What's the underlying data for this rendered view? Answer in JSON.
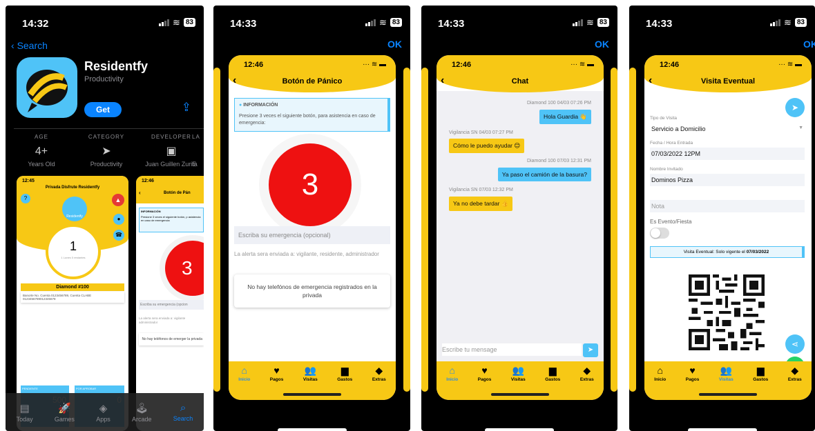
{
  "colors": {
    "accent_yellow": "#f7c815",
    "accent_blue": "#4fc3f7",
    "ios_blue": "#0a84ff",
    "panic_red": "#e11111"
  },
  "shot1": {
    "status": {
      "time": "14:32",
      "battery": "83"
    },
    "back_label": "Search",
    "app": {
      "name": "Residentfy",
      "category": "Productivity",
      "get_label": "Get"
    },
    "info": [
      {
        "header": "AGE",
        "value": "4+",
        "sub": "Years Old"
      },
      {
        "header": "CATEGORY",
        "value_icon": "location-arrow-icon",
        "sub": "Productivity"
      },
      {
        "header": "DEVELOPER",
        "value_icon": "person-square-icon",
        "sub": "Juan Guillen Zurita"
      },
      {
        "header": "LA",
        "value": "",
        "sub": "E"
      }
    ],
    "preview1": {
      "time": "12:45",
      "title": "Privada Disfrute Residentfy",
      "brand": "Residentfy",
      "count": "1",
      "count_sub": "1 Lunes 0 restantes",
      "name": "Diamond #100",
      "bank": "Banorte No. Cuenta 0123456789, Cuenta CLABE 0123456789012345678",
      "pend": "PENDIENTE",
      "pend_val": "500",
      "aprob": "POR APROBAR",
      "aprob_val": "0"
    },
    "preview2": {
      "time": "12:46",
      "title": "Botón de Pán",
      "info_title": "INFORMACIÓN",
      "info_text": "Presione 3 veces el siguiente botón, p asistencia en caso de emergencia",
      "number": "3",
      "placeholder": "Escriba su emergencia (opcion",
      "note": "La alerta sera enviada a: vigilante administrador",
      "card": "No hay teléfonos de emerger la privada"
    },
    "tabs": [
      {
        "label": "Today",
        "glyph": "▤",
        "active": false
      },
      {
        "label": "Games",
        "glyph": "🚀",
        "active": false
      },
      {
        "label": "Apps",
        "glyph": "◈",
        "active": false
      },
      {
        "label": "Arcade",
        "glyph": "🕹",
        "active": false
      },
      {
        "label": "Search",
        "glyph": "⌕",
        "active": true
      }
    ]
  },
  "shot2": {
    "status": {
      "time": "14:33",
      "battery": "83"
    },
    "ok_label": "OK",
    "phone_time": "12:46",
    "title": "Botón de Pánico",
    "info_title": "INFORMACIÓN",
    "info_text": "Presione 3 veces el siguiente botón, para asistencia en caso de emergencia:",
    "number": "3",
    "placeholder": "Escriba su emergencia (opcional)",
    "note": "La alerta sera enviada a: vigilante, residente, administrador",
    "card": "No hay telefónos de emergencia registrados en la privada"
  },
  "shot3": {
    "status": {
      "time": "14:33",
      "battery": "83"
    },
    "ok_label": "OK",
    "phone_time": "12:46",
    "title": "Chat",
    "messages": [
      {
        "from": "me",
        "meta": "Diamond 100  04/03 07:26 PM",
        "text": "Hola Guardia 👋"
      },
      {
        "from": "them",
        "meta": "Vigilancia SN  04/03 07:27 PM",
        "text": "Cómo le puedo ayudar 😊"
      },
      {
        "from": "me",
        "meta": "Diamond 100  07/03 12:31 PM",
        "text": "Ya paso el camión de la basura?"
      },
      {
        "from": "them",
        "meta": "Vigilancia SN  07/03 12:32 PM",
        "text": "Ya no debe tardar 👍"
      }
    ],
    "input_placeholder": "Escribe tu mensage"
  },
  "shot4": {
    "status": {
      "time": "14:33",
      "battery": "83"
    },
    "ok_label": "OK",
    "phone_time": "12:46",
    "title": "Visita Eventual",
    "fields": [
      {
        "label": "Tipo de Visita",
        "value": "Servicio a Domicilio"
      },
      {
        "label": "Fecha / Hora Entrada",
        "value": "07/03/2022 12PM"
      },
      {
        "label": "Nombre Invitado",
        "value": "Dominos Pizza"
      }
    ],
    "nota_placeholder": "Nota",
    "evento_label": "Es Evento/Fiesta",
    "notice_prefix": "Visita Eventual: Solo vigente el ",
    "notice_date": "07/03/2022"
  },
  "nav": [
    {
      "label": "Inicio",
      "glyph": "⌂"
    },
    {
      "label": "Pagos",
      "glyph": "♥"
    },
    {
      "label": "Visitas",
      "glyph": "👥"
    },
    {
      "label": "Gastos",
      "glyph": "▆"
    },
    {
      "label": "Extras",
      "glyph": "◆"
    }
  ]
}
